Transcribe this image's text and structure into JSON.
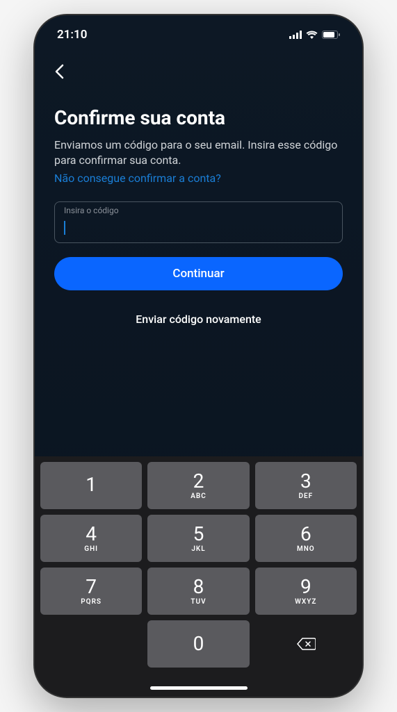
{
  "statusBar": {
    "time": "21:10"
  },
  "header": {
    "title": "Confirme sua conta",
    "description": "Enviamos um código para o seu email. Insira esse código para confirmar sua conta.",
    "helpLink": "Não consegue confirmar a conta?"
  },
  "form": {
    "inputLabel": "Insira o código",
    "inputValue": "",
    "continueButton": "Continuar",
    "resendButton": "Enviar código novamente"
  },
  "keyboard": {
    "keys": [
      [
        {
          "number": "1",
          "letters": " "
        },
        {
          "number": "2",
          "letters": "ABC"
        },
        {
          "number": "3",
          "letters": "DEF"
        }
      ],
      [
        {
          "number": "4",
          "letters": "GHI"
        },
        {
          "number": "5",
          "letters": "JKL"
        },
        {
          "number": "6",
          "letters": "MNO"
        }
      ],
      [
        {
          "number": "7",
          "letters": "PQRS"
        },
        {
          "number": "8",
          "letters": "TUV"
        },
        {
          "number": "9",
          "letters": "WXYZ"
        }
      ],
      [
        {
          "number": "",
          "letters": "",
          "blank": true
        },
        {
          "number": "0",
          "letters": ""
        },
        {
          "number": "",
          "letters": "",
          "delete": true
        }
      ]
    ]
  }
}
